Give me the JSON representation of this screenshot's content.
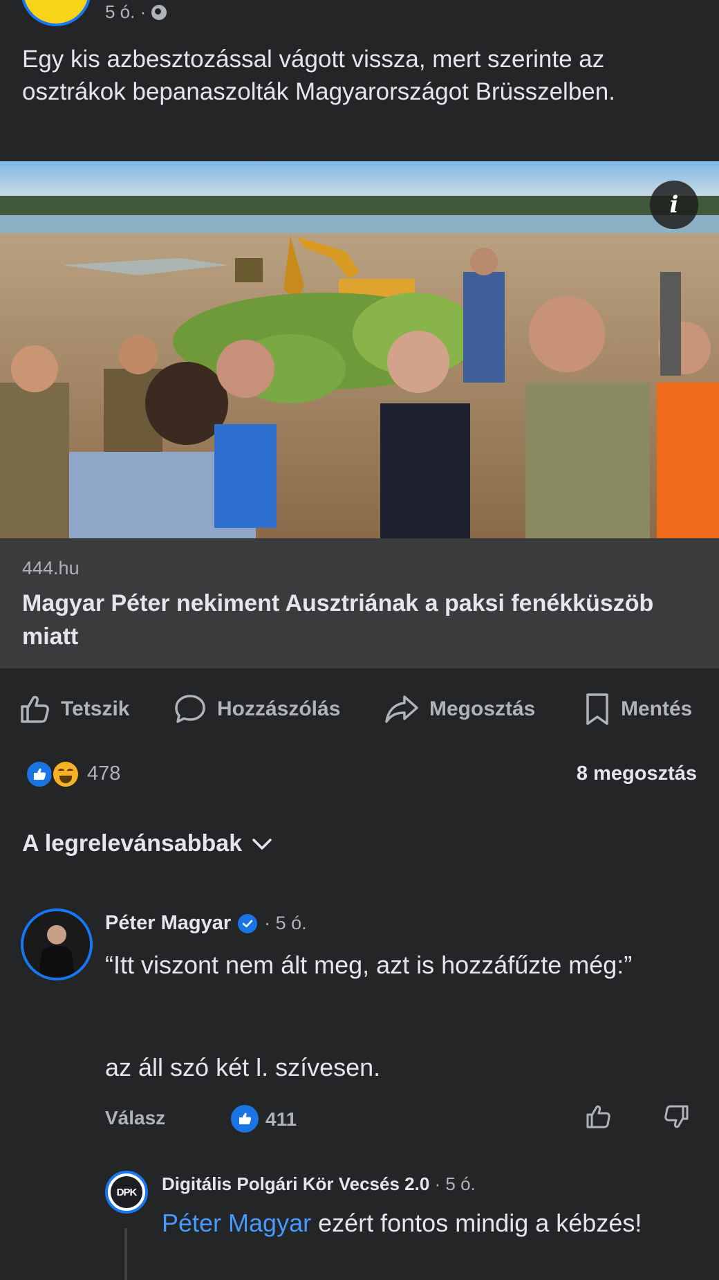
{
  "post": {
    "time": "5 ó. ·",
    "text": "Egy kis azbesztozással vágott vissza, mert szerinte az osztrákok bepanaszolták Magyarországot Brüsszelben."
  },
  "link": {
    "domain": "444.hu",
    "title": "Magyar Péter nekiment Ausztriának a paksi fenékküszöb miatt"
  },
  "actions": {
    "like": "Tetszik",
    "comment": "Hozzászólás",
    "share": "Megosztás",
    "save": "Mentés"
  },
  "stats": {
    "reactions": "478",
    "shares": "8 megosztás"
  },
  "sort": {
    "label": "A legrelevánsabbak"
  },
  "comment": {
    "author": "Péter Magyar",
    "time": "· 5 ó.",
    "line1": "“Itt viszont nem ált meg, azt is hozzáfűzte még:”",
    "line2": "az áll szó két l. szívesen.",
    "reply_label": "Válasz",
    "likes": "411"
  },
  "reply": {
    "avatar_text": "DPK",
    "author": "Digitális Polgári Kör Vecsés 2.0",
    "time": "· 5 ó.",
    "mention": "Péter Magyar",
    "text": " ezért fontos mindig a kébzés!"
  },
  "colors": {
    "background": "#242526",
    "card": "#3a3b3c",
    "accent": "#1b74e4",
    "mention": "#4599ff"
  }
}
